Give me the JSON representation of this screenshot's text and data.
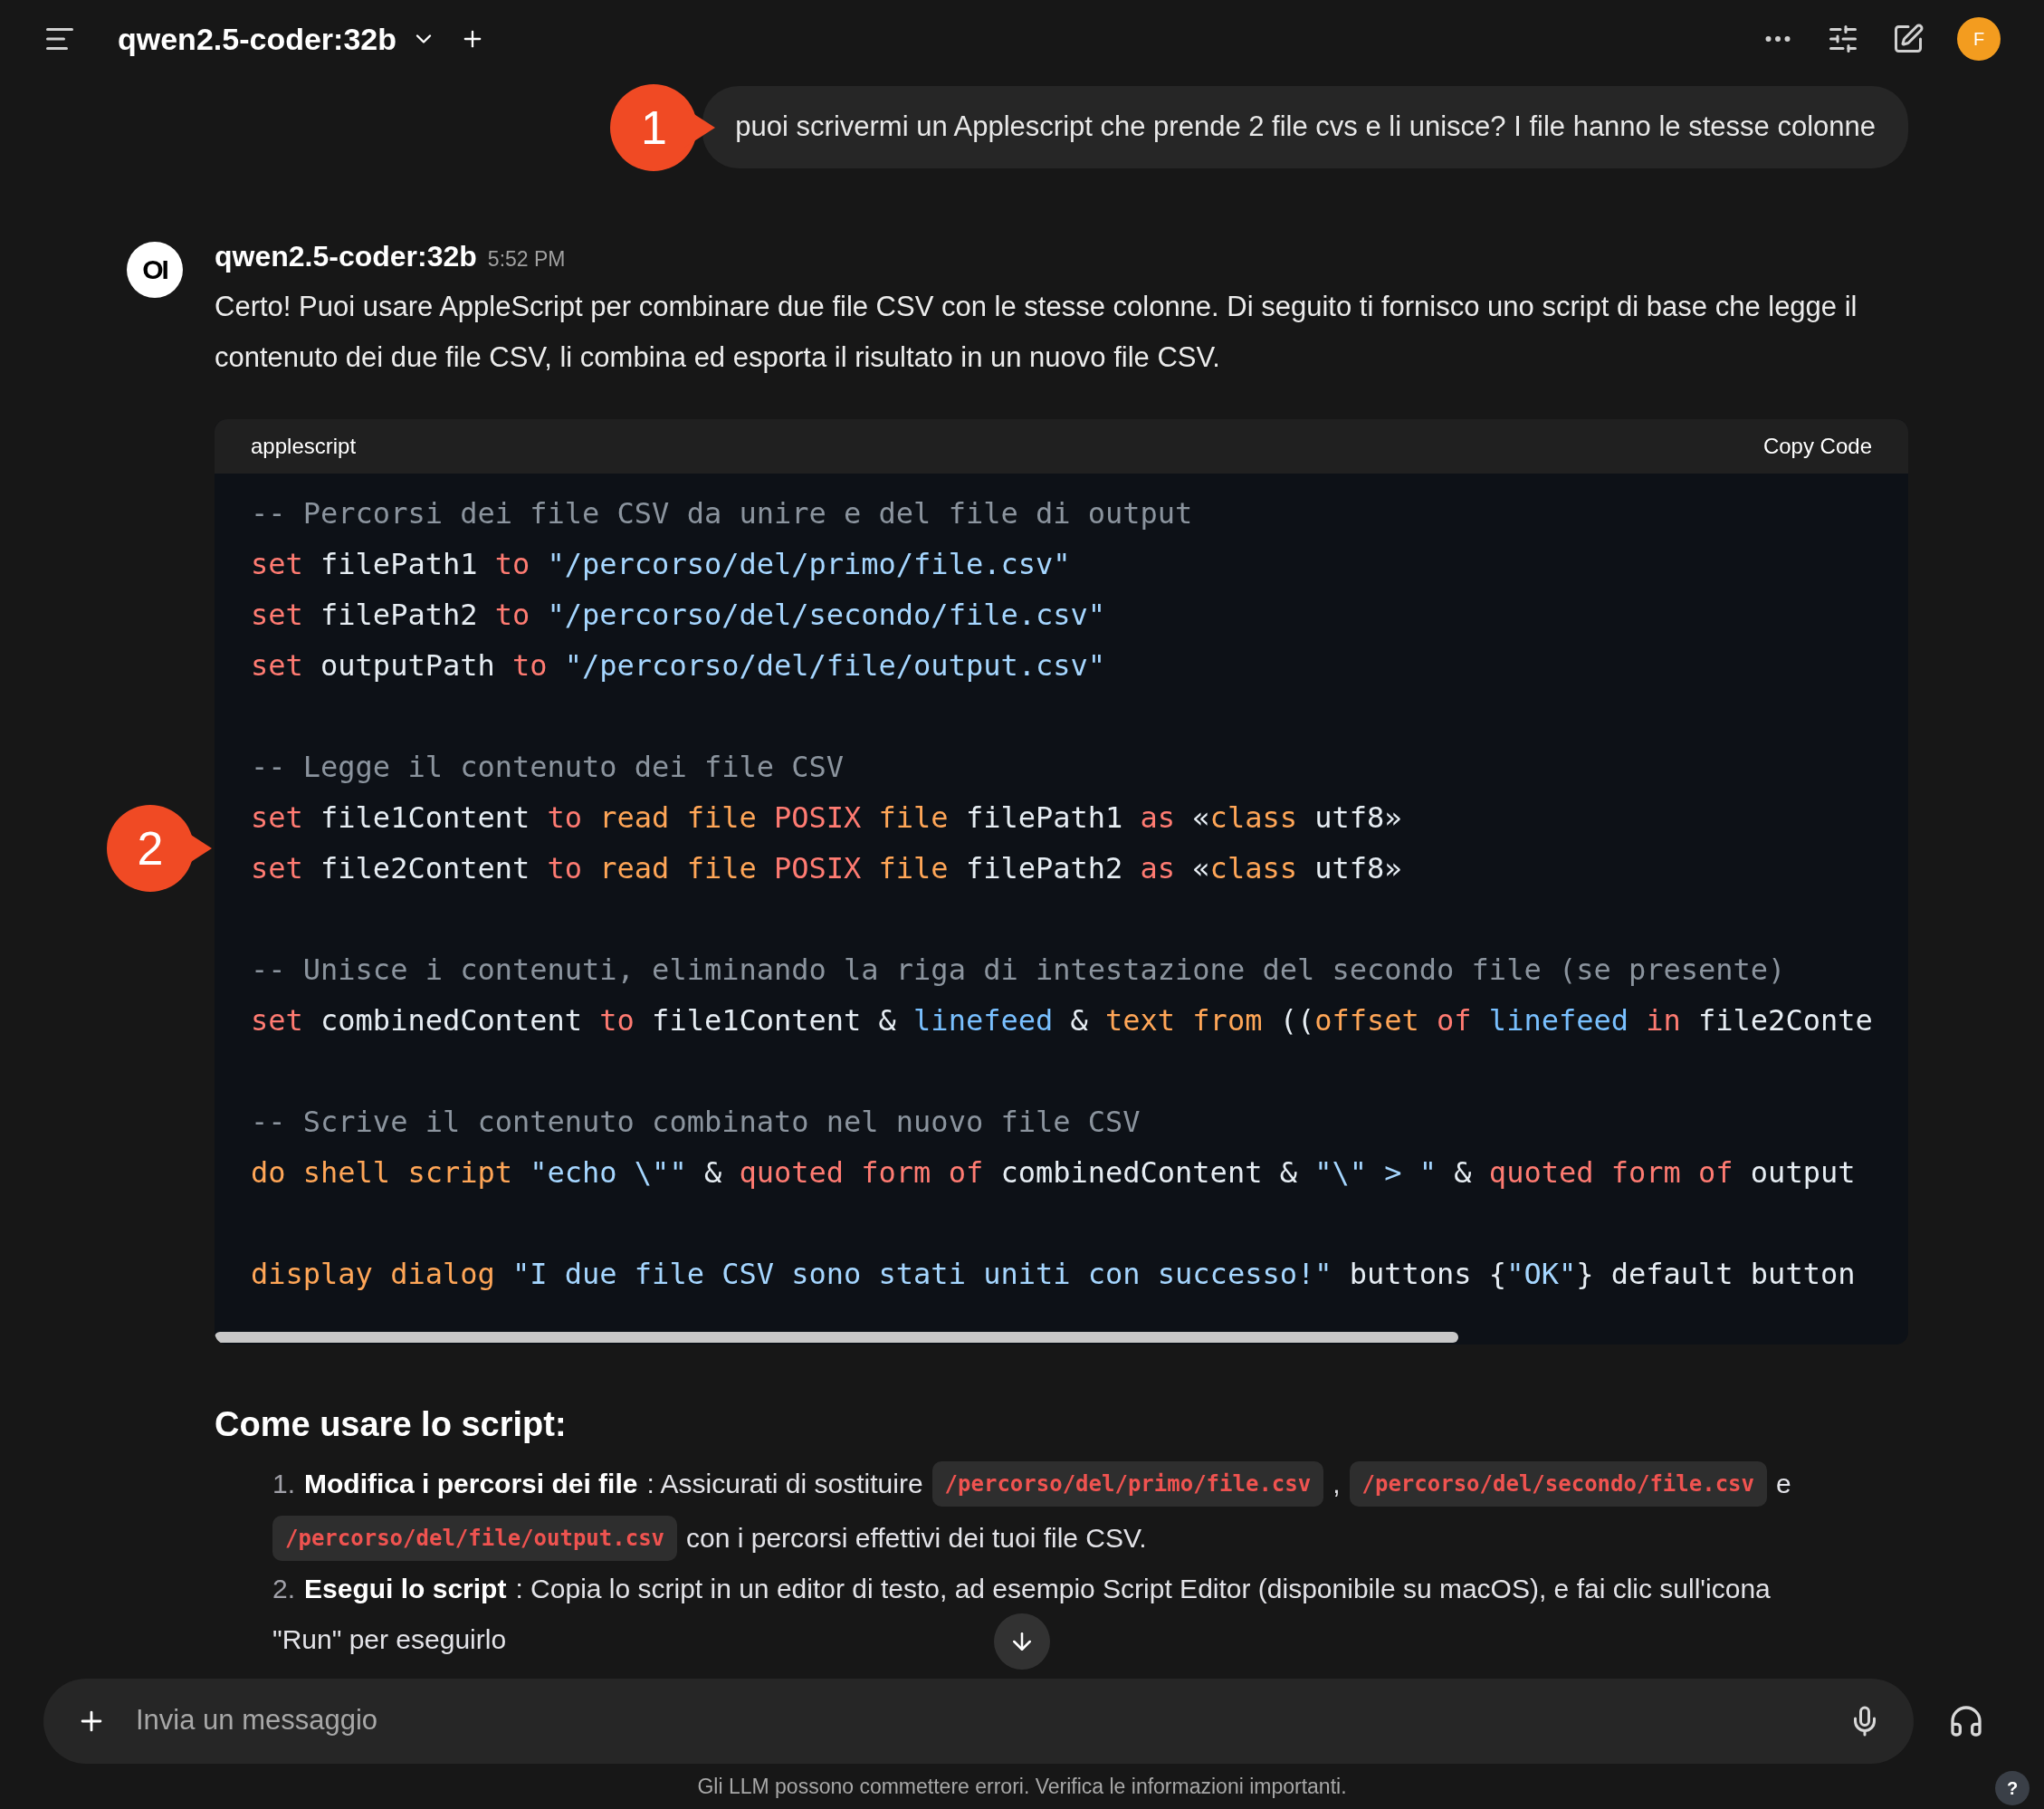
{
  "header": {
    "model": "qwen2.5-coder:32b",
    "avatar": "F"
  },
  "user_message": {
    "text": "puoi scrivermi un Applescript che prende 2 file cvs e li unisce? I file hanno le stesse colonne"
  },
  "callouts": [
    {
      "label": "1"
    },
    {
      "label": "2"
    }
  ],
  "assistant": {
    "logo": "OI",
    "name": "qwen2.5-coder:32b",
    "time": "5:52 PM",
    "intro": "Certo! Puoi usare AppleScript per combinare due file CSV con le stesse colonne. Di seguito ti fornisco uno script di base che legge il contenuto dei due file CSV, li combina ed esporta il risultato in un nuovo file CSV.",
    "code": {
      "language": "applescript",
      "copy_label": "Copy Code",
      "lines": [
        {
          "kind": "code",
          "segments": [
            {
              "kind": "comment",
              "text": "-- Percorsi dei file CSV da unire e del file di output"
            }
          ]
        },
        {
          "kind": "code",
          "segments": [
            {
              "kind": "keyword",
              "text": "set"
            },
            {
              "kind": "plain",
              "text": " filePath1 "
            },
            {
              "kind": "keyword",
              "text": "to "
            },
            {
              "kind": "string",
              "text": "\"/percorso/del/primo/file.csv\""
            }
          ]
        },
        {
          "kind": "code",
          "segments": [
            {
              "kind": "keyword",
              "text": "set"
            },
            {
              "kind": "plain",
              "text": " filePath2 "
            },
            {
              "kind": "keyword",
              "text": "to "
            },
            {
              "kind": "string",
              "text": "\"/percorso/del/secondo/file.csv\""
            }
          ]
        },
        {
          "kind": "code",
          "segments": [
            {
              "kind": "keyword",
              "text": "set"
            },
            {
              "kind": "plain",
              "text": " outputPath "
            },
            {
              "kind": "keyword",
              "text": "to "
            },
            {
              "kind": "string",
              "text": "\"/percorso/del/file/output.csv\""
            }
          ]
        },
        {
          "kind": "blank"
        },
        {
          "kind": "code",
          "segments": [
            {
              "kind": "comment",
              "text": "-- Legge il contenuto dei file CSV"
            }
          ]
        },
        {
          "kind": "code",
          "segments": [
            {
              "kind": "keyword",
              "text": "set"
            },
            {
              "kind": "plain",
              "text": " file1Content "
            },
            {
              "kind": "keyword",
              "text": "to "
            },
            {
              "kind": "command",
              "text": "read file "
            },
            {
              "kind": "keyword",
              "text": "POSIX "
            },
            {
              "kind": "command",
              "text": "file"
            },
            {
              "kind": "plain",
              "text": " filePath1 "
            },
            {
              "kind": "keyword",
              "text": "as"
            },
            {
              "kind": "plain",
              "text": " «"
            },
            {
              "kind": "command",
              "text": "class"
            },
            {
              "kind": "plain",
              "text": " utf8»"
            }
          ]
        },
        {
          "kind": "code",
          "segments": [
            {
              "kind": "keyword",
              "text": "set"
            },
            {
              "kind": "plain",
              "text": " file2Content "
            },
            {
              "kind": "keyword",
              "text": "to "
            },
            {
              "kind": "command",
              "text": "read file "
            },
            {
              "kind": "keyword",
              "text": "POSIX "
            },
            {
              "kind": "command",
              "text": "file"
            },
            {
              "kind": "plain",
              "text": " filePath2 "
            },
            {
              "kind": "keyword",
              "text": "as"
            },
            {
              "kind": "plain",
              "text": " «"
            },
            {
              "kind": "command",
              "text": "class"
            },
            {
              "kind": "plain",
              "text": " utf8»"
            }
          ]
        },
        {
          "kind": "blank"
        },
        {
          "kind": "code",
          "segments": [
            {
              "kind": "comment",
              "text": "-- Unisce i contenuti, eliminando la riga di intestazione del secondo file (se presente)"
            }
          ]
        },
        {
          "kind": "code",
          "segments": [
            {
              "kind": "keyword",
              "text": "set"
            },
            {
              "kind": "plain",
              "text": " combinedContent "
            },
            {
              "kind": "keyword",
              "text": "to"
            },
            {
              "kind": "plain",
              "text": " file1Content & "
            },
            {
              "kind": "builtin",
              "text": "linefeed"
            },
            {
              "kind": "plain",
              "text": " & "
            },
            {
              "kind": "command",
              "text": "text from"
            },
            {
              "kind": "plain",
              "text": " (("
            },
            {
              "kind": "command",
              "text": "offset "
            },
            {
              "kind": "keyword",
              "text": "of "
            },
            {
              "kind": "builtin",
              "text": "linefeed "
            },
            {
              "kind": "keyword",
              "text": "in"
            },
            {
              "kind": "plain",
              "text": " file2Conte"
            }
          ]
        },
        {
          "kind": "blank"
        },
        {
          "kind": "code",
          "segments": [
            {
              "kind": "comment",
              "text": "-- Scrive il contenuto combinato nel nuovo file CSV"
            }
          ]
        },
        {
          "kind": "code",
          "segments": [
            {
              "kind": "command",
              "text": "do shell script "
            },
            {
              "kind": "string",
              "text": "\"echo \\\"\""
            },
            {
              "kind": "plain",
              "text": " & "
            },
            {
              "kind": "keyword",
              "text": "quoted form of"
            },
            {
              "kind": "plain",
              "text": " combinedContent & "
            },
            {
              "kind": "string",
              "text": "\"\\\" > \""
            },
            {
              "kind": "plain",
              "text": " & "
            },
            {
              "kind": "keyword",
              "text": "quoted form of"
            },
            {
              "kind": "plain",
              "text": " output"
            }
          ]
        },
        {
          "kind": "blank"
        },
        {
          "kind": "code",
          "segments": [
            {
              "kind": "command",
              "text": "display dialog "
            },
            {
              "kind": "string",
              "text": "\"I due file CSV sono stati uniti con successo!\""
            },
            {
              "kind": "plain",
              "text": " buttons {"
            },
            {
              "kind": "string",
              "text": "\"OK\""
            },
            {
              "kind": "plain",
              "text": "} default button"
            }
          ]
        }
      ]
    },
    "section_title": "Come usare lo script:",
    "steps": [
      {
        "number": "1.",
        "title": "Modifica i percorsi dei file",
        "parts": [
          {
            "kind": "text",
            "text": ": Assicurati di sostituire"
          },
          {
            "kind": "code",
            "text": "/percorso/del/primo/file.csv"
          },
          {
            "kind": "text",
            "text": ","
          },
          {
            "kind": "code",
            "text": "/percorso/del/secondo/file.csv"
          },
          {
            "kind": "text",
            "text": "e"
          },
          {
            "kind": "code",
            "text": "/percorso/del/file/output.csv"
          },
          {
            "kind": "text",
            "text": "con i percorsi effettivi dei tuoi file CSV."
          }
        ]
      },
      {
        "number": "2.",
        "title": "Esegui lo script",
        "parts": [
          {
            "kind": "text",
            "text": ": Copia lo script in un editor di testo, ad esempio Script Editor (disponibile su macOS), e fai clic sull'icona"
          },
          {
            "kind": "text",
            "text": "\"Run\" per eseguirlo"
          }
        ]
      }
    ]
  },
  "composer": {
    "placeholder": "Invia un messaggio"
  },
  "footer": {
    "disclaimer": "Gli LLM possono commettere errori. Verifica le informazioni importanti.",
    "help": "?"
  }
}
